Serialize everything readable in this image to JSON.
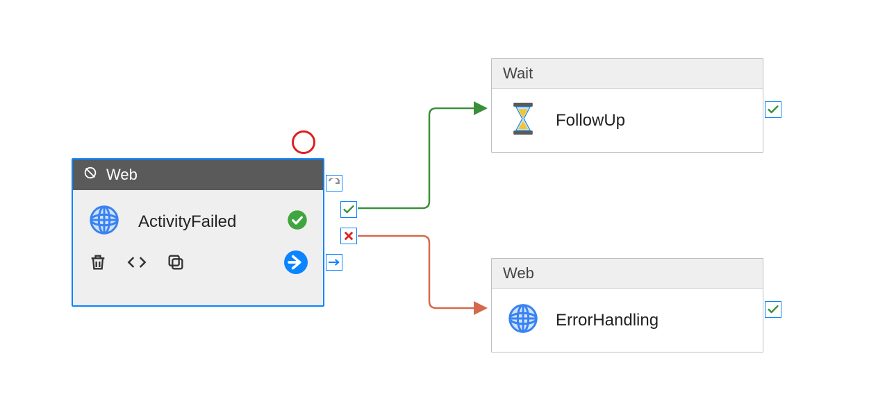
{
  "nodes": {
    "source": {
      "type": "Web",
      "type_label": "Web",
      "name": "ActivityFailed",
      "status": "Succeeded",
      "selected": true
    },
    "target_success": {
      "type": "Wait",
      "type_label": "Wait",
      "name": "FollowUp"
    },
    "target_failure": {
      "type": "Web",
      "type_label": "Web",
      "name": "ErrorHandling"
    }
  },
  "ports": {
    "completion": "completion",
    "success": "success",
    "failure": "failure",
    "skip": "skip"
  },
  "connectors": [
    {
      "from": "source",
      "port": "success",
      "to": "target_success",
      "color": "#3a8f3a"
    },
    {
      "from": "source",
      "port": "failure",
      "to": "target_failure",
      "color": "#d46a4b"
    }
  ],
  "toolbar": {
    "delete": "Delete",
    "code": "Code",
    "copy": "Copy",
    "go": "Open"
  }
}
